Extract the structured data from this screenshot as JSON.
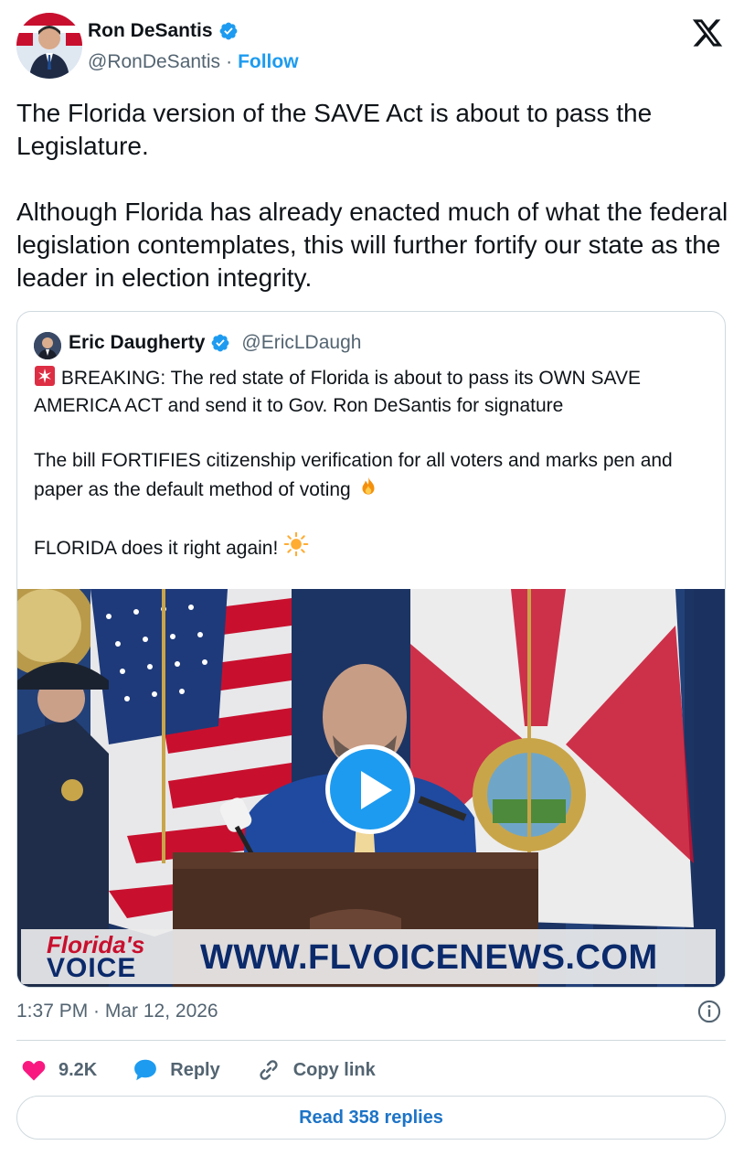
{
  "author": {
    "name": "Ron DeSantis",
    "handle": "@RonDeSantis",
    "separator": "·",
    "follow_label": "Follow",
    "verified": true
  },
  "tweet": {
    "text": "The Florida version of the SAVE Act is about to pass the Legislature.\n\nAlthough Florida has already enacted much of what the federal legislation contemplates, this will further fortify our state as the leader in election integrity."
  },
  "quoted_tweet": {
    "author_name": "Eric Daugherty",
    "author_handle": "@EricLDaugh",
    "verified": true,
    "line1": "BREAKING: The red state of Florida is about to pass its OWN SAVE AMERICA ACT and send it to Gov. Ron DeSantis for signature",
    "line2": "The bill FORTIFIES citizenship verification for all voters and marks pen and paper as the default method of voting",
    "line3": "FLORIDA does it right again!",
    "video": {
      "banner_logo_top": "Florida's",
      "banner_logo_bottom": "VOICE",
      "banner_url": "WWW.FLVOICENEWS.COM",
      "play_icon": "play-icon"
    }
  },
  "meta": {
    "timestamp": "1:37 PM · Mar 12, 2026"
  },
  "actions": {
    "likes_count": "9.2K",
    "reply_label": "Reply",
    "copy_link_label": "Copy link"
  },
  "read_replies_label": "Read 358 replies",
  "colors": {
    "accent": "#1d9bf0",
    "like": "#f91880",
    "text": "#0f1419",
    "secondary": "#536471",
    "border": "#cfd9de"
  }
}
